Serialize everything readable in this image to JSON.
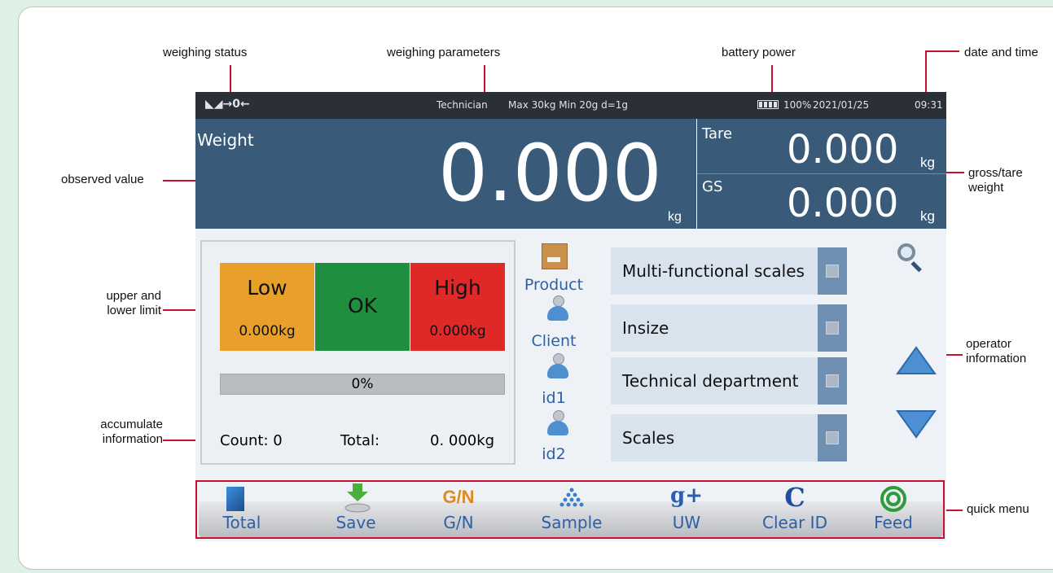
{
  "callouts": {
    "weighing_status": "weighing status",
    "weighing_parameters": "weighing parameters",
    "battery_power": "battery power",
    "date_and_time": "date and time",
    "observed_value": "observed value",
    "gross_tare_line1": "gross/tare",
    "gross_tare_line2": "weight",
    "upper_lower_line1": "upper and",
    "upper_lower_line2": "lower limit",
    "operator_line1": "operator",
    "operator_line2": "information",
    "accumulate_line1": "accumulate",
    "accumulate_line2": "information",
    "quick_menu": "quick menu"
  },
  "status_bar": {
    "status_icons": "◣◢→0←",
    "user": "Technician",
    "params": "Max 30kg  Min 20g  d=1g",
    "battery_percent": "100%",
    "date": "2021/01/25",
    "time": "09:31"
  },
  "weight": {
    "label": "Weight",
    "value": "0.000",
    "unit": "kg"
  },
  "tare": {
    "label": "Tare",
    "value": "0.000",
    "unit": "kg"
  },
  "gross": {
    "label": "GS",
    "value": "0.000",
    "unit": "kg"
  },
  "limits": {
    "low_label": "Low",
    "low_value": "0.000kg",
    "ok_label": "OK",
    "high_label": "High",
    "high_value": "0.000kg",
    "progress_text": "0%",
    "progress_fraction": 0,
    "count_text": "Count: 0",
    "total_label": "Total:",
    "total_value": "0. 000kg",
    "colors": {
      "low": "#e8a02a",
      "ok": "#1f8f3f",
      "high": "#e02828"
    }
  },
  "operator": {
    "rows": [
      {
        "label": "Product",
        "value": "Multi-functional  scales",
        "icon": "product-box-icon"
      },
      {
        "label": "Client",
        "value": "Insize",
        "icon": "person-icon"
      },
      {
        "label": "id1",
        "value": "Technical department",
        "icon": "person-icon"
      },
      {
        "label": "id2",
        "value": "Scales",
        "icon": "person-icon"
      }
    ]
  },
  "quick_menu": {
    "items": [
      {
        "label": "Total",
        "icon": "total-icon"
      },
      {
        "label": "Save",
        "icon": "save-icon"
      },
      {
        "label": "G/N",
        "icon": "gn-icon",
        "icon_text": "G/N"
      },
      {
        "label": "Sample",
        "icon": "sample-icon"
      },
      {
        "label": "UW",
        "icon": "uw-icon",
        "icon_text": "g+"
      },
      {
        "label": "Clear ID",
        "icon": "clear-id-icon",
        "icon_text": "C"
      },
      {
        "label": "Feed",
        "icon": "feed-icon"
      }
    ]
  }
}
